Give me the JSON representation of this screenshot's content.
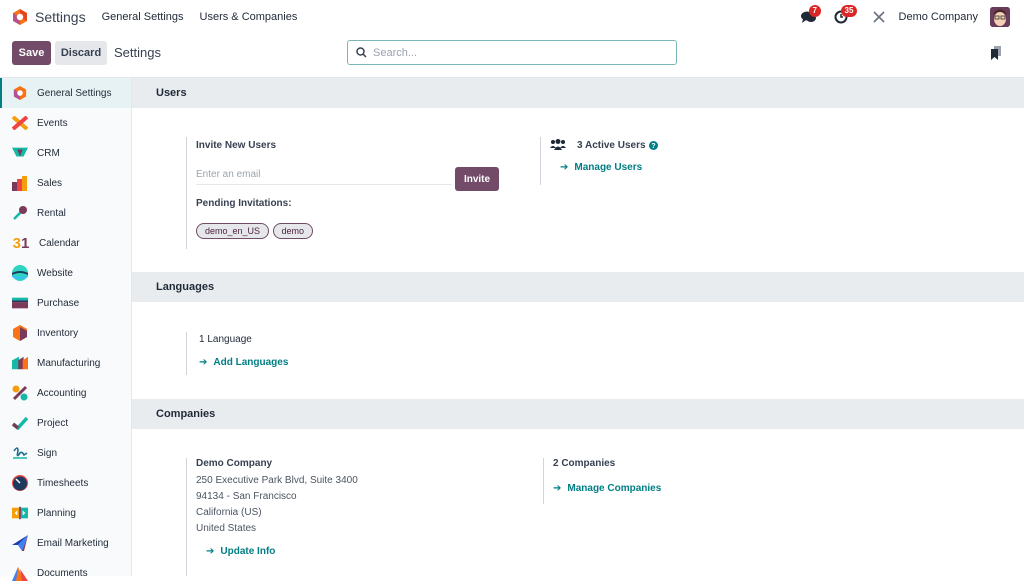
{
  "navbar": {
    "app_title": "Settings",
    "menu": [
      "General Settings",
      "Users & Companies"
    ],
    "messages_badge": "7",
    "activities_badge": "35",
    "company": "Demo Company"
  },
  "control": {
    "save_label": "Save",
    "discard_label": "Discard",
    "title": "Settings",
    "search_placeholder": "Search..."
  },
  "sidebar": {
    "items": [
      {
        "label": "General Settings",
        "icon": "settings-icon",
        "active": true
      },
      {
        "label": "Events",
        "icon": "events-icon"
      },
      {
        "label": "CRM",
        "icon": "crm-icon"
      },
      {
        "label": "Sales",
        "icon": "sales-icon"
      },
      {
        "label": "Rental",
        "icon": "rental-icon"
      },
      {
        "label": "Calendar",
        "icon": "calendar-icon"
      },
      {
        "label": "Website",
        "icon": "website-icon"
      },
      {
        "label": "Purchase",
        "icon": "purchase-icon"
      },
      {
        "label": "Inventory",
        "icon": "inventory-icon"
      },
      {
        "label": "Manufacturing",
        "icon": "manufacturing-icon"
      },
      {
        "label": "Accounting",
        "icon": "accounting-icon"
      },
      {
        "label": "Project",
        "icon": "project-icon"
      },
      {
        "label": "Sign",
        "icon": "sign-icon"
      },
      {
        "label": "Timesheets",
        "icon": "timesheets-icon"
      },
      {
        "label": "Planning",
        "icon": "planning-icon"
      },
      {
        "label": "Email Marketing",
        "icon": "email-marketing-icon"
      },
      {
        "label": "Documents",
        "icon": "documents-icon"
      }
    ],
    "calendar_glyph": "31"
  },
  "users": {
    "heading": "Users",
    "invite_label": "Invite New Users",
    "email_placeholder": "Enter an email",
    "invite_button": "Invite",
    "pending_label": "Pending Invitations:",
    "pending": [
      "demo_en_US",
      "demo"
    ],
    "active_users": "3 Active Users",
    "manage_users": "Manage Users"
  },
  "languages": {
    "heading": "Languages",
    "count": "1 Language",
    "add": "Add Languages"
  },
  "companies": {
    "heading": "Companies",
    "name": "Demo Company",
    "address": [
      "250 Executive Park Blvd, Suite 3400",
      "94134 - San Francisco",
      "California (US)",
      "United States"
    ],
    "update": "Update Info",
    "count": "2 Companies",
    "manage": "Manage Companies"
  },
  "colors": {
    "primary": "#714b67",
    "link": "#017e84",
    "badge": "#dc2626"
  }
}
